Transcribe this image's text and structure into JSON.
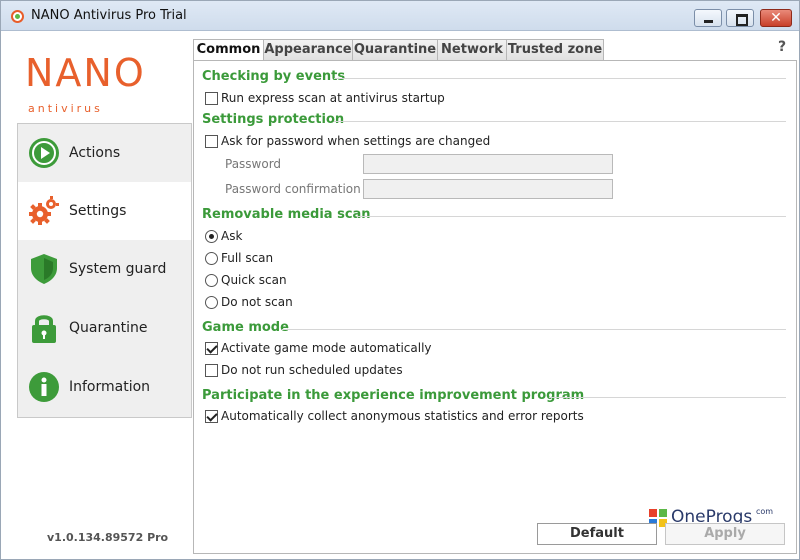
{
  "window": {
    "title": "NANO Antivirus Pro Trial"
  },
  "brand": {
    "name": "NANO",
    "sub": "antivirus",
    "version": "v1.0.134.89572 Pro"
  },
  "nav": [
    {
      "label": "Actions",
      "icon": "play-icon"
    },
    {
      "label": "Settings",
      "icon": "gears-icon",
      "active": true
    },
    {
      "label": "System guard",
      "icon": "shield-icon"
    },
    {
      "label": "Quarantine",
      "icon": "lock-icon"
    },
    {
      "label": "Information",
      "icon": "info-icon"
    }
  ],
  "tabs": [
    "Common",
    "Appearance",
    "Quarantine",
    "Network",
    "Trusted zone"
  ],
  "active_tab": "Common",
  "help": "?",
  "sections": {
    "checking": {
      "title": "Checking by events",
      "express_scan": {
        "label": "Run express scan at antivirus startup",
        "checked": false
      }
    },
    "protection": {
      "title": "Settings protection",
      "ask_password": {
        "label": "Ask for password when settings are changed",
        "checked": false
      },
      "password_label": "Password",
      "password_value": "",
      "confirm_label": "Password confirmation",
      "confirm_value": ""
    },
    "removable": {
      "title": "Removable media scan",
      "options": [
        "Ask",
        "Full scan",
        "Quick scan",
        "Do not scan"
      ],
      "selected": "Ask"
    },
    "game": {
      "title": "Game mode",
      "auto": {
        "label": "Activate game mode automatically",
        "checked": true
      },
      "no_updates": {
        "label": "Do not run scheduled updates",
        "checked": false
      }
    },
    "experience": {
      "title": "Participate in the experience improvement program",
      "collect": {
        "label": "Automatically collect anonymous statistics and error reports",
        "checked": true
      }
    }
  },
  "buttons": {
    "default": "Default",
    "apply": "Apply"
  },
  "watermark": {
    "text": "OneProgs",
    "suffix": "com"
  },
  "colors": {
    "accent_green": "#3b9a3a",
    "brand_orange": "#e8602c",
    "icon_green": "#3d9b3a"
  }
}
